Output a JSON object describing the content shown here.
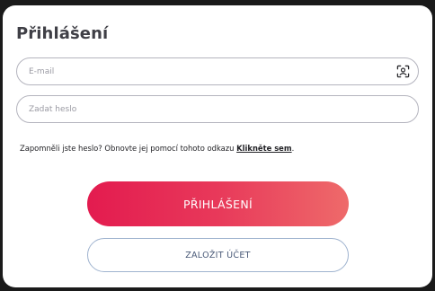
{
  "login": {
    "title": "Přihlášení",
    "email_placeholder": "E-mail",
    "password_placeholder": "Zadat heslo",
    "scan_icon": "face-scan-icon",
    "forgot_text": "Zapomněli jste heslo? Obnovte jej pomocí tohoto odkazu ",
    "forgot_link": "Klikněte sem",
    "forgot_end": ".",
    "login_button": "PŘIHLÁŠENÍ",
    "register_button": "ZALOŽIT ÚČET"
  },
  "colors": {
    "primary_gradient_start": "#e31b4f",
    "primary_gradient_end": "#ee6a6a",
    "secondary_border": "#9fb3cf"
  }
}
